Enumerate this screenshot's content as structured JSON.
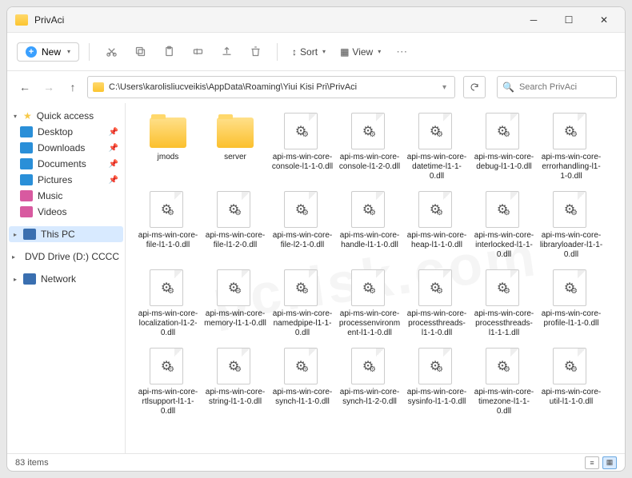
{
  "window": {
    "title": "PrivAci"
  },
  "toolbar": {
    "new_label": "New",
    "sort_label": "Sort",
    "view_label": "View"
  },
  "address": {
    "path": "C:\\Users\\karolisliucveikis\\AppData\\Roaming\\Yiui Kisi Pri\\PrivAci"
  },
  "search": {
    "placeholder": "Search PrivAci"
  },
  "sidebar": {
    "quick": "Quick access",
    "desktop": "Desktop",
    "downloads": "Downloads",
    "documents": "Documents",
    "pictures": "Pictures",
    "music": "Music",
    "videos": "Videos",
    "thispc": "This PC",
    "dvd": "DVD Drive (D:) CCCC",
    "network": "Network"
  },
  "status": {
    "count": "83 items"
  },
  "files": [
    {
      "type": "folder",
      "name": "jmods"
    },
    {
      "type": "folder",
      "name": "server"
    },
    {
      "type": "dll",
      "name": "api-ms-win-core-console-l1-1-0.dll"
    },
    {
      "type": "dll",
      "name": "api-ms-win-core-console-l1-2-0.dll"
    },
    {
      "type": "dll",
      "name": "api-ms-win-core-datetime-l1-1-0.dll"
    },
    {
      "type": "dll",
      "name": "api-ms-win-core-debug-l1-1-0.dll"
    },
    {
      "type": "dll",
      "name": "api-ms-win-core-errorhandling-l1-1-0.dll"
    },
    {
      "type": "dll",
      "name": "api-ms-win-core-file-l1-1-0.dll"
    },
    {
      "type": "dll",
      "name": "api-ms-win-core-file-l1-2-0.dll"
    },
    {
      "type": "dll",
      "name": "api-ms-win-core-file-l2-1-0.dll"
    },
    {
      "type": "dll",
      "name": "api-ms-win-core-handle-l1-1-0.dll"
    },
    {
      "type": "dll",
      "name": "api-ms-win-core-heap-l1-1-0.dll"
    },
    {
      "type": "dll",
      "name": "api-ms-win-core-interlocked-l1-1-0.dll"
    },
    {
      "type": "dll",
      "name": "api-ms-win-core-libraryloader-l1-1-0.dll"
    },
    {
      "type": "dll",
      "name": "api-ms-win-core-localization-l1-2-0.dll"
    },
    {
      "type": "dll",
      "name": "api-ms-win-core-memory-l1-1-0.dll"
    },
    {
      "type": "dll",
      "name": "api-ms-win-core-namedpipe-l1-1-0.dll"
    },
    {
      "type": "dll",
      "name": "api-ms-win-core-processenvironment-l1-1-0.dll"
    },
    {
      "type": "dll",
      "name": "api-ms-win-core-processthreads-l1-1-0.dll"
    },
    {
      "type": "dll",
      "name": "api-ms-win-core-processthreads-l1-1-1.dll"
    },
    {
      "type": "dll",
      "name": "api-ms-win-core-profile-l1-1-0.dll"
    },
    {
      "type": "dll",
      "name": "api-ms-win-core-rtlsupport-l1-1-0.dll"
    },
    {
      "type": "dll",
      "name": "api-ms-win-core-string-l1-1-0.dll"
    },
    {
      "type": "dll",
      "name": "api-ms-win-core-synch-l1-1-0.dll"
    },
    {
      "type": "dll",
      "name": "api-ms-win-core-synch-l1-2-0.dll"
    },
    {
      "type": "dll",
      "name": "api-ms-win-core-sysinfo-l1-1-0.dll"
    },
    {
      "type": "dll",
      "name": "api-ms-win-core-timezone-l1-1-0.dll"
    },
    {
      "type": "dll",
      "name": "api-ms-win-core-util-l1-1-0.dll"
    }
  ]
}
